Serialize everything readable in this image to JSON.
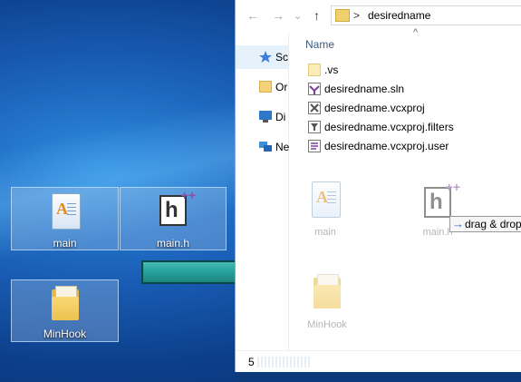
{
  "desktop": {
    "icons": [
      {
        "label": "main",
        "icon": "text-document-icon"
      },
      {
        "label": "main.h",
        "icon": "header-file-icon"
      },
      {
        "label": "MinHook",
        "icon": "folder-icon"
      }
    ],
    "arrow_icon": "right-arrow-icon"
  },
  "explorer": {
    "nav_buttons": [
      "back-arrow-icon",
      "forward-arrow-icon",
      "up-arrow-icon"
    ],
    "breadcrumb": {
      "separator": ">",
      "folder": "desiredname"
    },
    "nav_pane": [
      {
        "label": "Sc",
        "icon": "star-icon"
      },
      {
        "label": "Or",
        "icon": "folder-icon"
      },
      {
        "label": "Di",
        "icon": "monitor-icon"
      },
      {
        "label": "Ne",
        "icon": "network-icon"
      }
    ],
    "column_header": "Name",
    "sort_indicator": "^",
    "files": [
      {
        "name": ".vs",
        "icon": "folder-icon"
      },
      {
        "name": "desiredname.sln",
        "icon": "solution-file-icon"
      },
      {
        "name": "desiredname.vcxproj",
        "icon": "project-file-icon"
      },
      {
        "name": "desiredname.vcxproj.filters",
        "icon": "filters-file-icon"
      },
      {
        "name": "desiredname.vcxproj.user",
        "icon": "user-file-icon"
      }
    ],
    "drag_ghosts": [
      {
        "label": "main"
      },
      {
        "label": "main.h"
      },
      {
        "label": "MinHook"
      }
    ],
    "drag_tooltip": "drag & drop",
    "status": {
      "item_count": "5"
    }
  },
  "colors": {
    "desktop_blue": "#1a5fb8",
    "tile_border": "#c8e1ff",
    "arrow_teal": "#2aa6a0"
  }
}
